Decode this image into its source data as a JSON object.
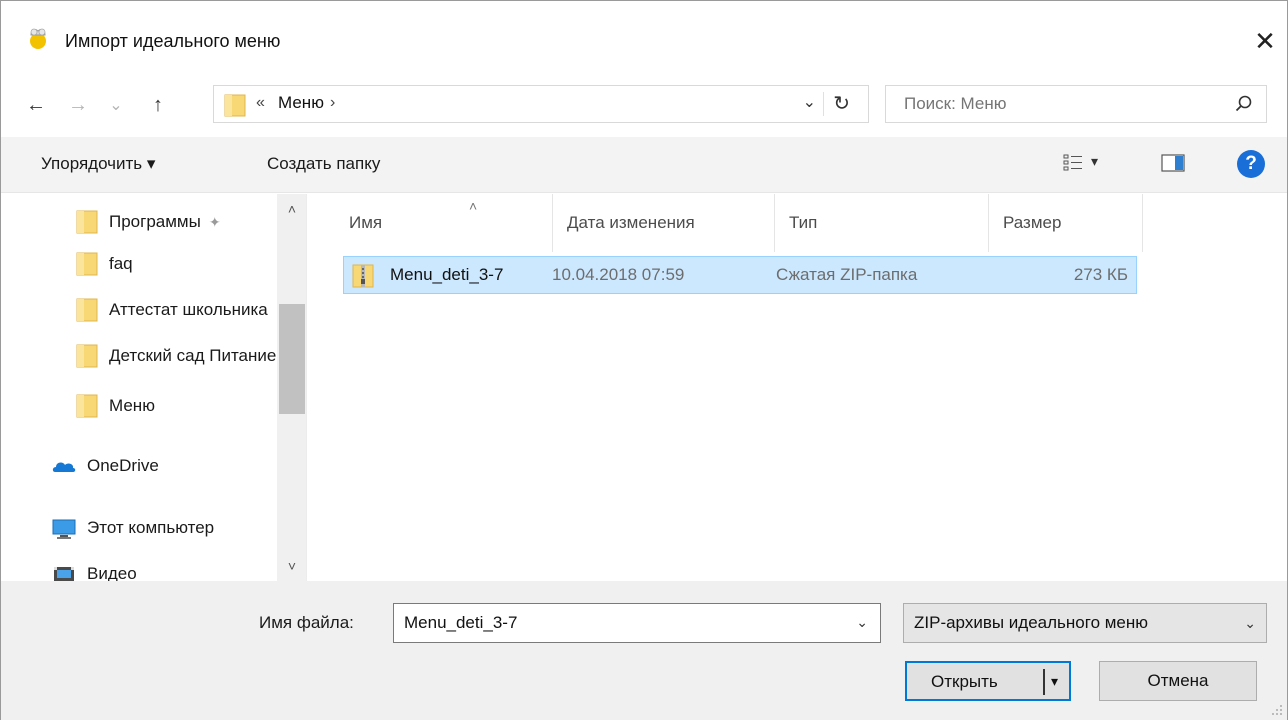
{
  "window": {
    "title": "Импорт идеального меню",
    "close_glyph": "✕"
  },
  "navigation": {
    "back_glyph": "←",
    "forward_glyph": "→",
    "recent_glyph": "⌄",
    "up_glyph": "↑"
  },
  "address": {
    "overflow": "«",
    "crumb": "Меню",
    "crumb_arrow": "›",
    "dropdown_glyph": "⌄",
    "refresh_glyph": "↻"
  },
  "search": {
    "placeholder": "Поиск: Меню"
  },
  "toolbar": {
    "organize": "Упорядочить ▾",
    "new_folder": "Создать папку",
    "view_dropdown": "▾",
    "help": "?"
  },
  "nav_pane": {
    "items": [
      {
        "label": "Программы",
        "icon": "folder-icon",
        "pinned": true
      },
      {
        "label": "faq",
        "icon": "folder-icon"
      },
      {
        "label": "Аттестат школьника",
        "icon": "folder-icon"
      },
      {
        "label": "Детский сад Питание",
        "icon": "folder-icon"
      },
      {
        "label": "Меню",
        "icon": "folder-icon"
      },
      {
        "label": "OneDrive",
        "icon": "onedrive-icon"
      },
      {
        "label": "Этот компьютер",
        "icon": "computer-icon"
      },
      {
        "label": "Видео",
        "icon": "video-icon"
      }
    ],
    "pin_glyph": "✦",
    "scroll_up": "˄",
    "scroll_down": "˅"
  },
  "file_list": {
    "sort_indicator": "˄",
    "columns": [
      "Имя",
      "Дата изменения",
      "Тип",
      "Размер"
    ],
    "rows": [
      {
        "name": "Menu_deti_3-7",
        "modified": "10.04.2018 07:59",
        "type": "Сжатая ZIP-папка",
        "size": "273 КБ",
        "icon": "zip-folder-icon",
        "selected": true
      }
    ]
  },
  "bottom": {
    "filename_label": "Имя файла:",
    "filename_value": "Menu_deti_3-7",
    "filter_value": "ZIP-архивы идеального меню",
    "dropdown_glyph": "⌄",
    "open_label": "Открыть",
    "open_split_glyph": "▾",
    "cancel_label": "Отмена"
  },
  "colors": {
    "selection_bg": "#cce8ff",
    "selection_border": "#99d1ff",
    "accent": "#0078d7",
    "help": "#1a6ed8"
  }
}
